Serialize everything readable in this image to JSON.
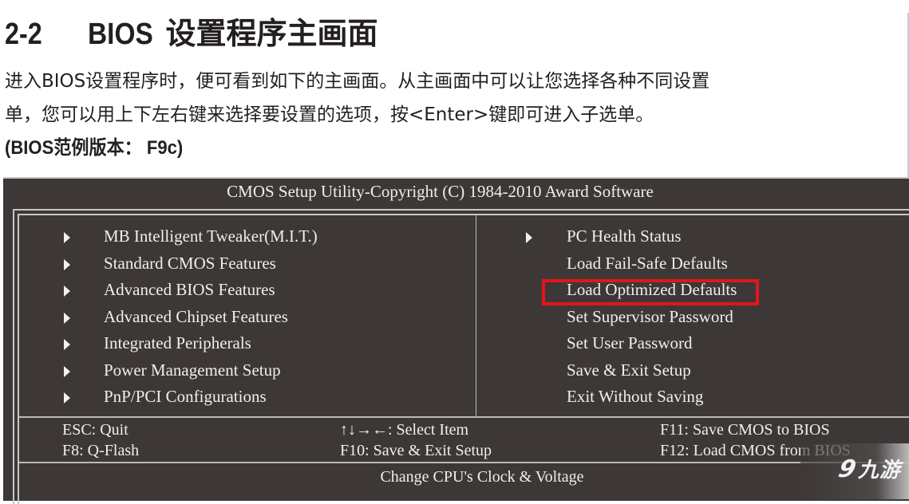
{
  "document": {
    "section_number": "2-2",
    "section_title_latin": "BIOS",
    "section_title_cjk": "设置程序主画面",
    "paragraph_line1": "进入BIOS设置程序时，便可看到如下的主画面。从主画面中可以让您选择各种不同设置",
    "paragraph_line2": "单，您可以用上下左右键来选择要设置的选项，按<Enter>键即可进入子选单。",
    "version_note": "(BIOS范例版本： F9c)"
  },
  "bios": {
    "title": "CMOS Setup Utility-Copyright (C) 1984-2010 Award Software",
    "left_menu": [
      {
        "label": "MB Intelligent Tweaker(M.I.T.)",
        "has_submenu": true
      },
      {
        "label": "Standard CMOS Features",
        "has_submenu": true
      },
      {
        "label": "Advanced BIOS Features",
        "has_submenu": true
      },
      {
        "label": "Advanced Chipset Features",
        "has_submenu": true
      },
      {
        "label": "Integrated Peripherals",
        "has_submenu": true
      },
      {
        "label": "Power Management Setup",
        "has_submenu": true
      },
      {
        "label": "PnP/PCI Configurations",
        "has_submenu": true
      }
    ],
    "right_menu": [
      {
        "label": "PC Health Status",
        "has_submenu": true
      },
      {
        "label": "Load Fail-Safe Defaults",
        "has_submenu": false
      },
      {
        "label": "Load Optimized Defaults",
        "has_submenu": false,
        "highlighted": true
      },
      {
        "label": "Set Supervisor Password",
        "has_submenu": false
      },
      {
        "label": "Set User Password",
        "has_submenu": false
      },
      {
        "label": "Save & Exit Setup",
        "has_submenu": false
      },
      {
        "label": "Exit Without Saving",
        "has_submenu": false
      }
    ],
    "keys": {
      "esc": "ESC: Quit",
      "f8": "F8: Q-Flash",
      "arrows": "↑↓→←: Select Item",
      "f10": "F10: Save & Exit Setup",
      "f11": "F11: Save CMOS to BIOS",
      "f12": "F12: Load CMOS from BIOS"
    },
    "status_text": "Change CPU's Clock & Voltage",
    "highlight_color": "#e3151a",
    "background_color": "#3d3837"
  },
  "watermark": {
    "logo_glyph": "9",
    "logo_text": "九游"
  }
}
